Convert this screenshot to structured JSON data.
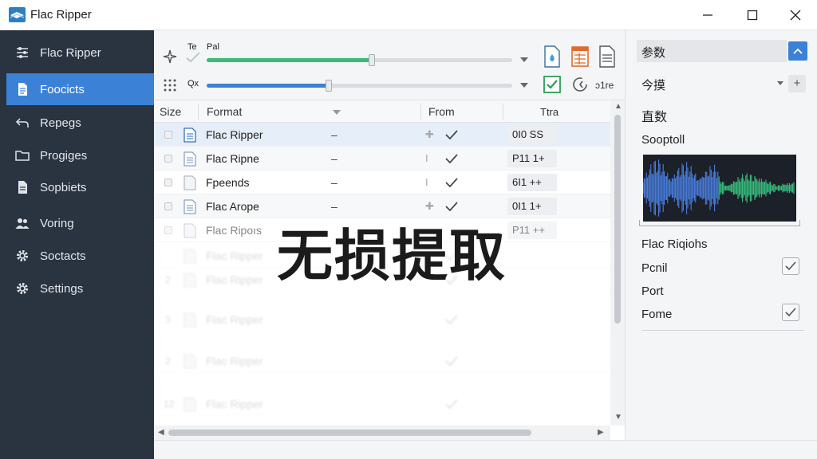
{
  "window": {
    "title": "Flac Ripper"
  },
  "sidebar": {
    "items": [
      {
        "label": "Flac Ripper",
        "icon": "sliders-icon"
      },
      {
        "label": "Foocicts",
        "icon": "document-icon",
        "active": true
      },
      {
        "label": "Repegs",
        "icon": "back-arrow-icon"
      },
      {
        "label": "Progiges",
        "icon": "folder-icon"
      },
      {
        "label": "Sopbiets",
        "icon": "page-icon"
      },
      {
        "label": "Voring",
        "icon": "users-icon"
      },
      {
        "label": "Soctacts",
        "icon": "gear-icon"
      },
      {
        "label": "Settings",
        "icon": "gear-icon"
      }
    ]
  },
  "toolbar": {
    "row1": {
      "label_a": "Te",
      "label_b": "Pal",
      "slider_fraction": 0.54,
      "color": "#3dba7b"
    },
    "row2": {
      "label_a": "Qx",
      "slider_fraction": 0.4,
      "color": "#3b82d6"
    },
    "readout": "ↄ1re"
  },
  "table": {
    "columns": [
      "Size",
      "Format",
      "From",
      "Ttra"
    ],
    "rows": [
      {
        "name": "Flac Ripper",
        "dash": "–",
        "extra": "0I0 SS",
        "selected": true
      },
      {
        "name": "Flac Ripne",
        "dash": "–",
        "extra": "P11 1+"
      },
      {
        "name": "Fpeends",
        "dash": "–",
        "extra": "6I1 ++"
      },
      {
        "name": "Flac Arope",
        "dash": "–",
        "extra": "0I1 1+"
      },
      {
        "name": "Flac Ripoıs",
        "dash": "",
        "extra": "P11 ++"
      }
    ],
    "faded_rows": [
      {
        "name": "Flac Ripper",
        "num": ""
      },
      {
        "name": "Flac Ripper",
        "num": "2"
      },
      {
        "name": "Flac Ripper",
        "num": "3"
      },
      {
        "name": "Flac Ripper",
        "num": "2"
      },
      {
        "name": "Flac Ripper",
        "num": "12"
      }
    ]
  },
  "overlay": {
    "text": "无损提取"
  },
  "right_panel": {
    "header": "参数",
    "field_label": "今摸",
    "section_title": "直数",
    "waveform_label": "Sooptoll",
    "list_title": "Flac Riqiohs",
    "options": [
      {
        "label": "Pcnil",
        "checked": true
      },
      {
        "label": "Port",
        "checked": false
      },
      {
        "label": "Fome",
        "checked": true
      }
    ]
  },
  "colors": {
    "accent": "#3b82d6",
    "green": "#3dba7b",
    "sidebar": "#2a3340"
  }
}
